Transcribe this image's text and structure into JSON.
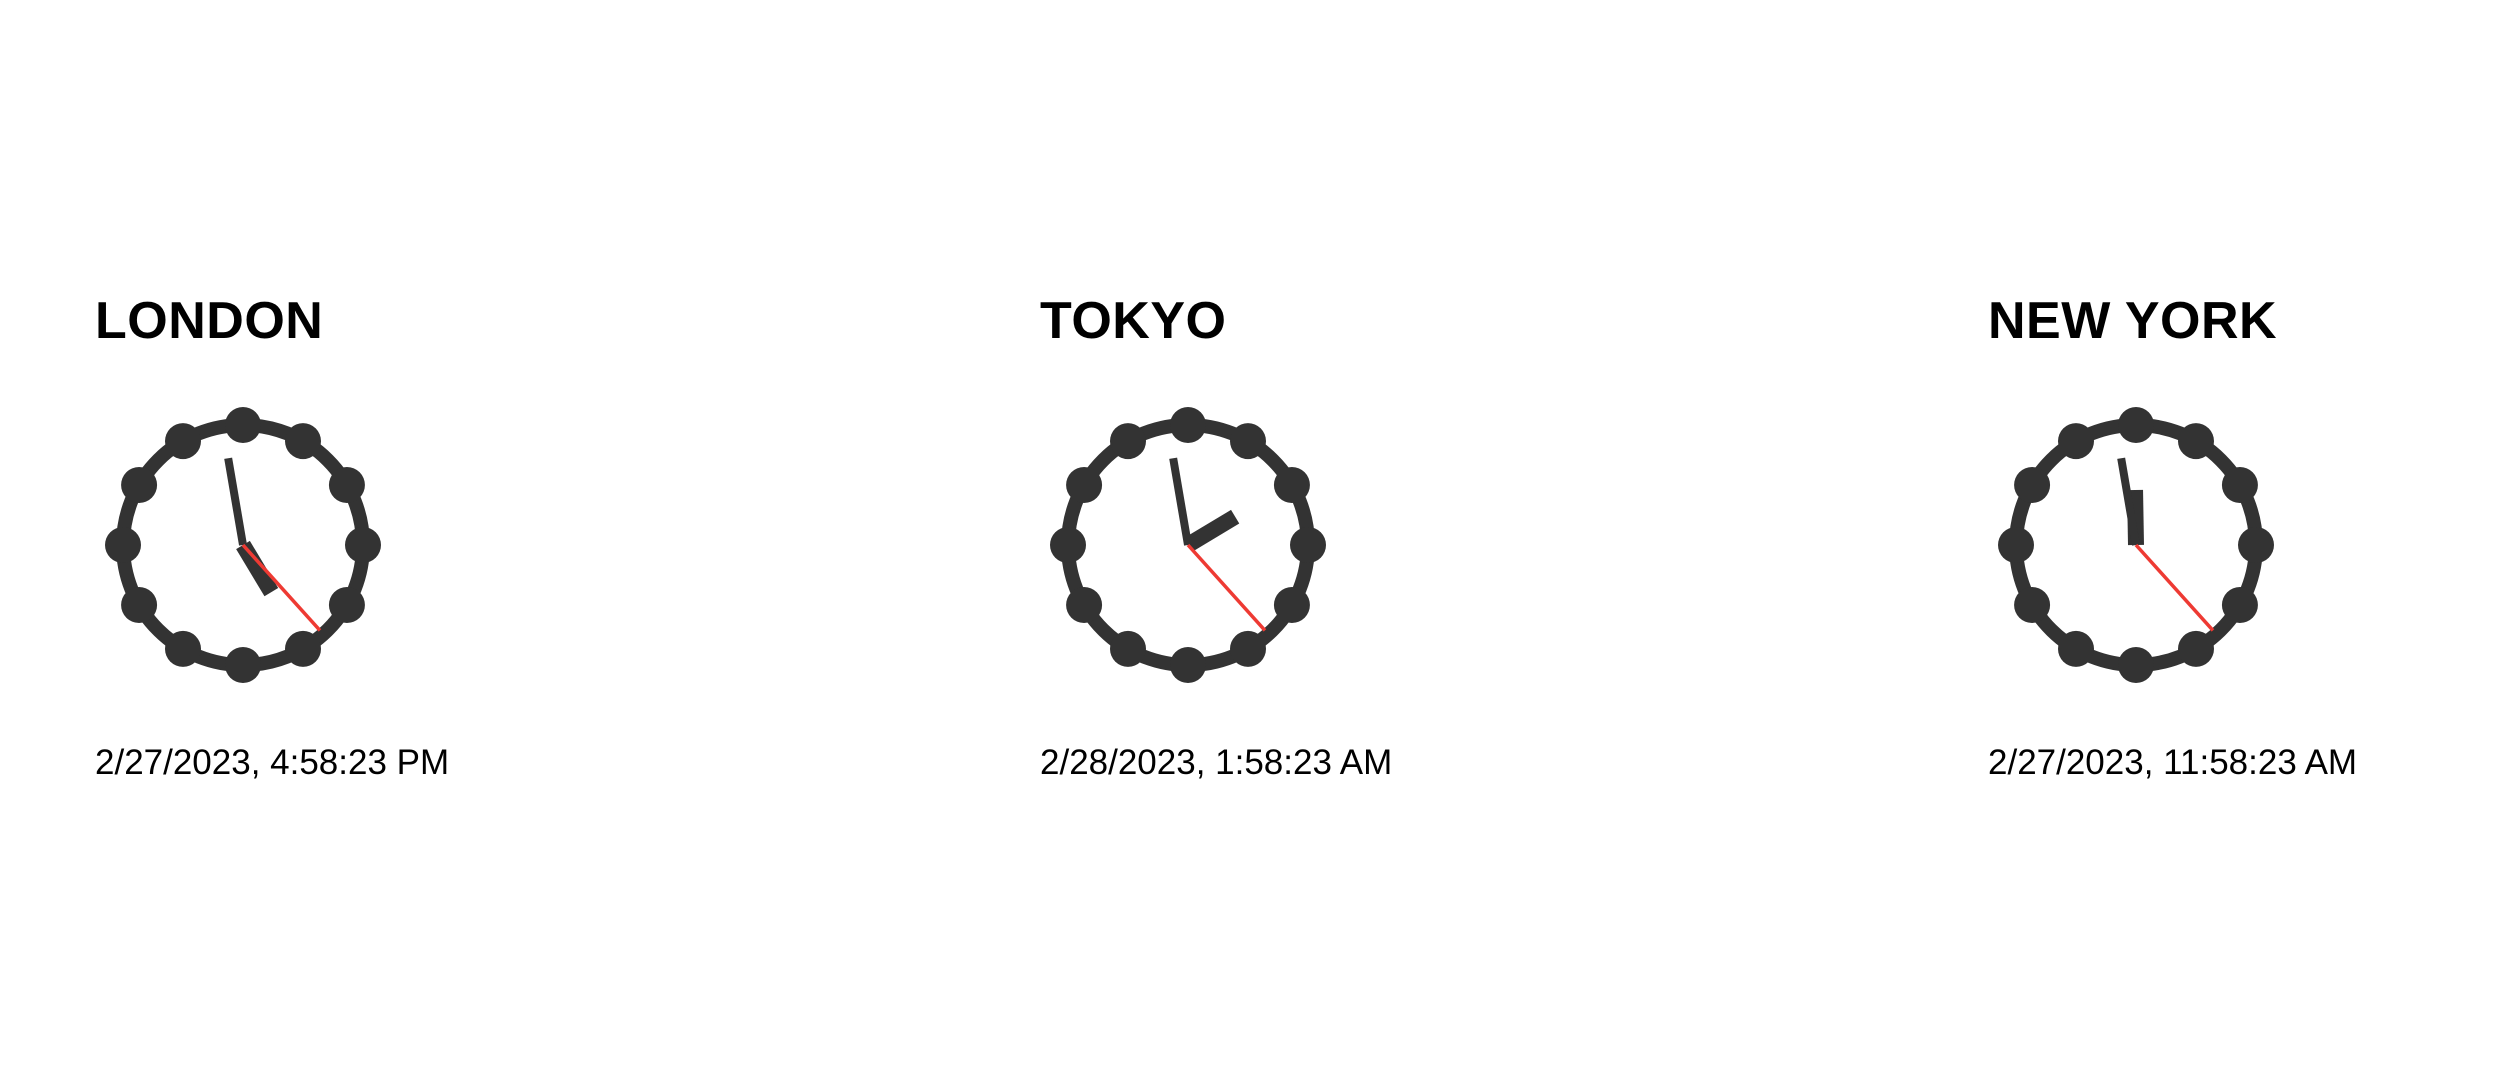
{
  "colors": {
    "clock_body": "#333333",
    "second_hand": "#ee3a33",
    "background": "#ffffff"
  },
  "clocks": [
    {
      "city": "LONDON",
      "datetime": "2/27/2023, 4:58:23 PM",
      "time": {
        "hours": 16,
        "minutes": 58,
        "seconds": 23
      }
    },
    {
      "city": "TOKYO",
      "datetime": "2/28/2023, 1:58:23 AM",
      "time": {
        "hours": 1,
        "minutes": 58,
        "seconds": 23
      }
    },
    {
      "city": "NEW YORK",
      "datetime": "2/27/2023, 11:58:23 AM",
      "time": {
        "hours": 11,
        "minutes": 58,
        "seconds": 23
      }
    }
  ]
}
